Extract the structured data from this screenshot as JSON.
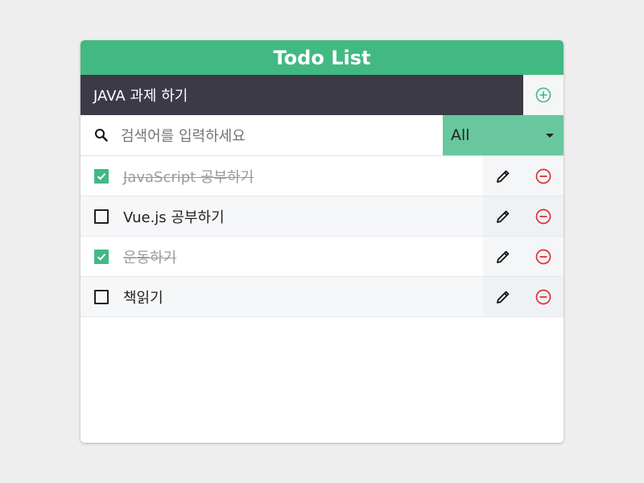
{
  "app": {
    "title": "Todo List"
  },
  "new_todo": {
    "value": "JAVA 과제 하기",
    "add_icon": "plus-circle-icon"
  },
  "search": {
    "placeholder": "검색어를 입력하세요",
    "icon": "search-icon"
  },
  "filter": {
    "selected": "All"
  },
  "colors": {
    "accent": "#42b983",
    "input_bg": "#3b3a46",
    "filter_bg": "#68c79e",
    "delete": "#e03131"
  },
  "todos": [
    {
      "text": "JavaScript 공부하기",
      "done": true
    },
    {
      "text": "Vue.js 공부하기",
      "done": false
    },
    {
      "text": "운동하기",
      "done": true
    },
    {
      "text": "책읽기",
      "done": false
    }
  ]
}
